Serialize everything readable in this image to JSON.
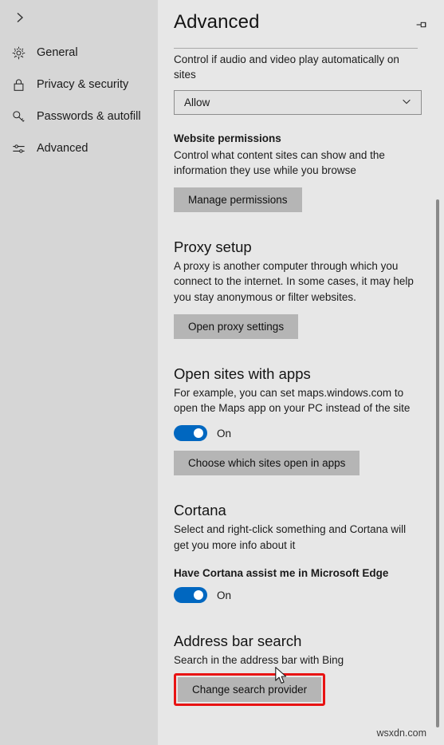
{
  "sidebar": {
    "back_icon": "chevron-right-icon",
    "items": [
      {
        "label": "General",
        "icon": "gear-icon"
      },
      {
        "label": "Privacy & security",
        "icon": "lock-icon"
      },
      {
        "label": "Passwords & autofill",
        "icon": "key-icon"
      },
      {
        "label": "Advanced",
        "icon": "sliders-icon"
      }
    ]
  },
  "header": {
    "title": "Advanced",
    "pin_icon": "pin-icon"
  },
  "main": {
    "media_autoplay": {
      "description": "Control if audio and video play automatically on sites",
      "select_value": "Allow",
      "caret_icon": "chevron-down-icon"
    },
    "website_permissions": {
      "subhead": "Website permissions",
      "description": "Control what content sites can show and the information they use while you browse",
      "button": "Manage permissions"
    },
    "proxy_setup": {
      "title": "Proxy setup",
      "description": "A proxy is another computer through which you connect to the internet. In some cases, it may help you stay anonymous or filter websites.",
      "button": "Open proxy settings"
    },
    "open_sites_with_apps": {
      "title": "Open sites with apps",
      "description": "For example, you can set maps.windows.com to open the Maps app on your PC instead of the site",
      "toggle_state": "On",
      "button": "Choose which sites open in apps"
    },
    "cortana": {
      "title": "Cortana",
      "description": "Select and right-click something and Cortana will get you more info about it",
      "subhead": "Have Cortana assist me in Microsoft Edge",
      "toggle_state": "On"
    },
    "address_bar_search": {
      "title": "Address bar search",
      "description": "Search in the address bar with Bing",
      "button": "Change search provider"
    }
  },
  "watermark": "wsxdn.com",
  "colors": {
    "accent_toggle": "#0067c0",
    "highlight_box": "#e81313",
    "sidebar_bg": "#d6d6d6",
    "main_bg": "#e7e7e7",
    "button_bg": "#b5b5b5"
  }
}
